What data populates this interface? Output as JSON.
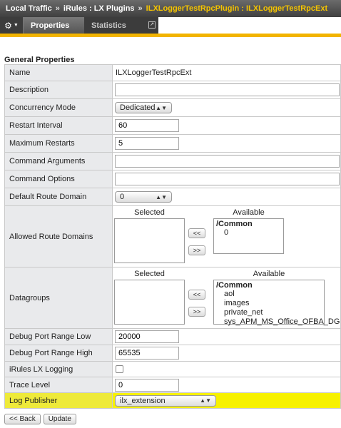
{
  "breadcrumb": {
    "items": [
      "Local Traffic",
      "iRules : LX Plugins",
      "ILXLoggerTestRpcPlugin : ILXLoggerTestRpcExt"
    ],
    "separator": "»"
  },
  "tabs": {
    "gear_icon": "gear-icon",
    "items": [
      {
        "label": "Properties",
        "active": true
      },
      {
        "label": "Statistics",
        "active": false
      }
    ]
  },
  "section_title": "General Properties",
  "fields": {
    "name": {
      "label": "Name",
      "value": "ILXLoggerTestRpcExt"
    },
    "description": {
      "label": "Description",
      "value": ""
    },
    "concurrency_mode": {
      "label": "Concurrency Mode",
      "value": "Dedicated"
    },
    "restart_interval": {
      "label": "Restart Interval",
      "value": "60"
    },
    "maximum_restarts": {
      "label": "Maximum Restarts",
      "value": "5"
    },
    "command_arguments": {
      "label": "Command Arguments",
      "value": ""
    },
    "command_options": {
      "label": "Command Options",
      "value": ""
    },
    "default_route_domain": {
      "label": "Default Route Domain",
      "value": "0"
    },
    "allowed_route_domains": {
      "label": "Allowed Route Domains",
      "selected_header": "Selected",
      "available_header": "Available",
      "selected": [],
      "available_group": "/Common",
      "available": [
        "0"
      ]
    },
    "datagroups": {
      "label": "Datagroups",
      "selected_header": "Selected",
      "available_header": "Available",
      "selected": [],
      "available_group": "/Common",
      "available": [
        "aol",
        "images",
        "private_net",
        "sys_APM_MS_Office_OFBA_DG"
      ]
    },
    "debug_port_low": {
      "label": "Debug Port Range Low",
      "value": "20000"
    },
    "debug_port_high": {
      "label": "Debug Port Range High",
      "value": "65535"
    },
    "irules_lx_logging": {
      "label": "iRules LX Logging",
      "checked": false
    },
    "trace_level": {
      "label": "Trace Level",
      "value": "0"
    },
    "log_publisher": {
      "label": "Log Publisher",
      "value": "ilx_extension"
    }
  },
  "move_buttons": {
    "add": "<<",
    "remove": ">>"
  },
  "footer": {
    "back_label": "<< Back",
    "update_label": "Update"
  },
  "colors": {
    "accent": "#f2b400",
    "highlight": "#f7f100",
    "crumb_current": "#f5c400"
  }
}
